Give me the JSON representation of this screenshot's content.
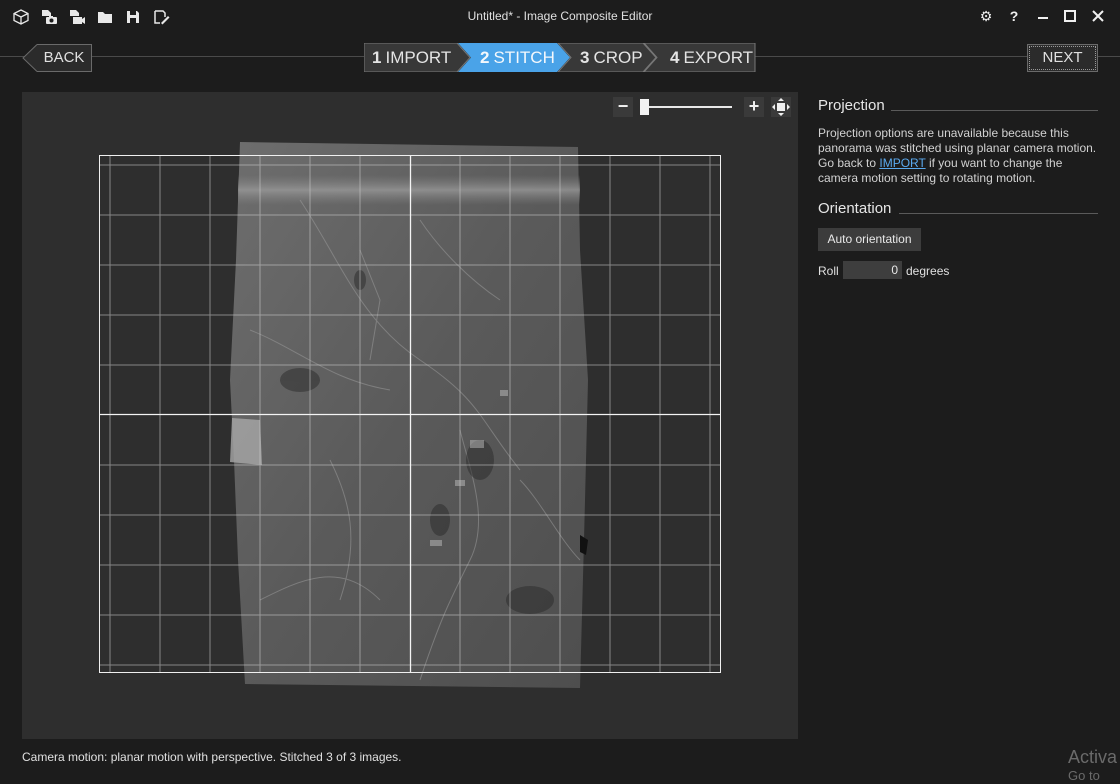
{
  "window": {
    "title": "Untitled* - Image Composite Editor"
  },
  "toolbar": {
    "icons": [
      "new-project-icon",
      "import-photos-icon",
      "import-video-icon",
      "open-icon",
      "save-icon",
      "save-as-icon"
    ]
  },
  "window_controls": {
    "settings": "⚙",
    "help": "?",
    "minimize": "—",
    "maximize": "☐",
    "close": "✕"
  },
  "nav": {
    "back": "BACK",
    "next": "NEXT"
  },
  "steps": [
    {
      "num": "1",
      "label": "IMPORT",
      "active": false
    },
    {
      "num": "2",
      "label": "STITCH",
      "active": true
    },
    {
      "num": "3",
      "label": "CROP",
      "active": false
    },
    {
      "num": "4",
      "label": "EXPORT",
      "active": false
    }
  ],
  "zoom": {
    "minus": "−",
    "plus": "+",
    "level": 0.03
  },
  "panel": {
    "projection_heading": "Projection",
    "projection_text_1": "Projection options are unavailable because this panorama was stitched using planar camera motion. Go back to ",
    "projection_link": "IMPORT",
    "projection_text_2": " if you want to change the camera motion setting to rotating motion.",
    "orientation_heading": "Orientation",
    "auto_orientation": "Auto orientation",
    "roll_label": "Roll",
    "roll_value": "0",
    "roll_unit": "degrees"
  },
  "status": "Camera motion: planar motion with perspective. Stitched 3 of 3 images.",
  "watermark": {
    "line1": "Activa",
    "line2": "Go to"
  },
  "colors": {
    "accent": "#4aa3e8",
    "background": "#1c1c1c",
    "canvas": "#2e2e2e"
  }
}
